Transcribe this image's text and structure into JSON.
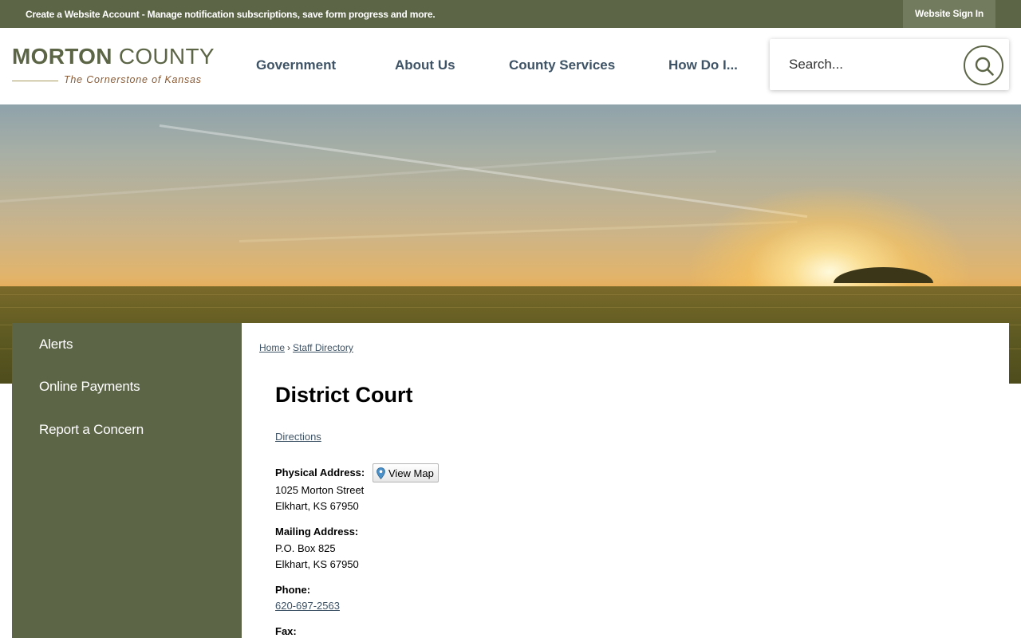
{
  "topbar": {
    "create_account_label": "Create a Website Account",
    "create_account_rest": " - Manage notification subscriptions, save form progress and more.",
    "signin_label": "Website Sign In"
  },
  "logo": {
    "name_bold": "MORTON",
    "name_rest": " COUNTY",
    "tagline": "The Cornerstone of Kansas"
  },
  "nav": {
    "items": [
      {
        "label": "Government"
      },
      {
        "label": "About Us"
      },
      {
        "label": "County Services"
      },
      {
        "label": "How Do I..."
      }
    ]
  },
  "search": {
    "placeholder": "Search..."
  },
  "sidebar": {
    "items": [
      {
        "label": "Alerts"
      },
      {
        "label": "Online Payments"
      },
      {
        "label": "Report a Concern"
      }
    ]
  },
  "breadcrumb": {
    "home": "Home",
    "separator": "›",
    "current": "Staff Directory"
  },
  "page": {
    "title": "District Court",
    "directions_label": "Directions",
    "physical_label": "Physical Address:",
    "view_map_label": "View Map",
    "physical_line1": "1025 Morton Street",
    "physical_line2": "Elkhart, KS 67950",
    "mailing_label": "Mailing Address:",
    "mailing_line1": "P.O. Box 825",
    "mailing_line2": "Elkhart, KS 67950",
    "phone_label": "Phone:",
    "phone_value": "620-697-2563",
    "fax_label": "Fax:"
  },
  "colors": {
    "brand_green": "#5c6647",
    "nav_text": "#3e5366",
    "tagline": "#8a5a34"
  }
}
